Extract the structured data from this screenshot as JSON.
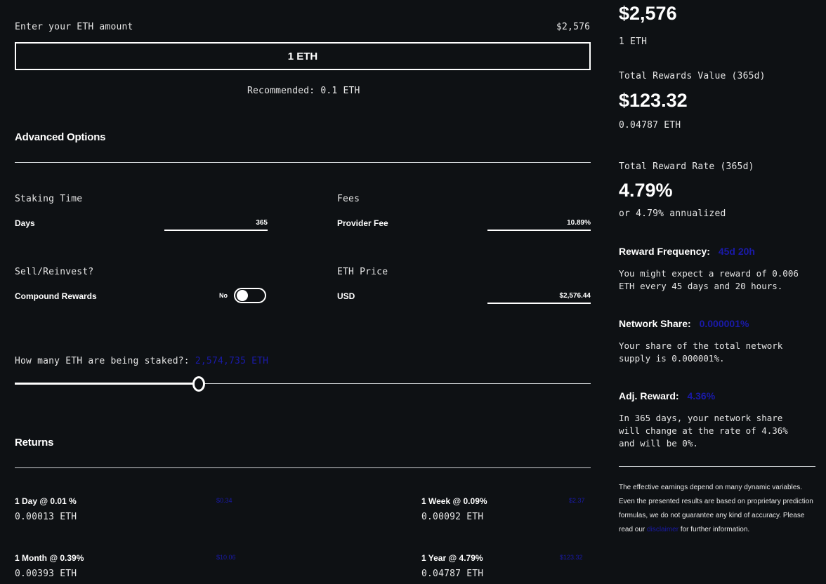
{
  "stake": {
    "amount_label": "Enter your ETH amount",
    "amount_usd": "$2,576",
    "input_value": "1 ETH",
    "recommended": "Recommended: 0.1 ETH"
  },
  "advanced": {
    "title": "Advanced Options",
    "staking_time": {
      "label": "Staking Time",
      "field_label": "Days",
      "value": "365"
    },
    "fees": {
      "label": "Fees",
      "field_label": "Provider Fee",
      "value": "10.89%"
    },
    "sell_reinvest": {
      "label": "Sell/Reinvest?",
      "field_label": "Compound Rewards",
      "toggle_text": "No"
    },
    "eth_price": {
      "label": "ETH Price",
      "field_label": "USD",
      "value": "$2,576.44"
    }
  },
  "slider": {
    "label": "How many ETH are being staked?:",
    "value_text": "2,574,735 ETH",
    "fill_fraction": 0.32
  },
  "returns": {
    "title": "Returns",
    "items": [
      {
        "title": "1 Day @ 0.01 %",
        "usd": "$0.34",
        "eth": "0.00013 ETH"
      },
      {
        "title": "1 Week @ 0.09%",
        "usd": "$2.37",
        "eth": "0.00092 ETH"
      },
      {
        "title": "1 Month @ 0.39%",
        "usd": "$10.06",
        "eth": "0.00393 ETH"
      },
      {
        "title": "1 Year @ 4.79%",
        "usd": "$123.32",
        "eth": "0.04787 ETH"
      }
    ]
  },
  "summary": {
    "top_value": "$2,576",
    "top_eth": "1 ETH",
    "total_rewards_label": "Total Rewards Value (365d)",
    "total_rewards_value": "$123.32",
    "total_rewards_eth": "0.04787 ETH",
    "reward_rate_label": "Total Reward Rate (365d)",
    "reward_rate_value": "4.79%",
    "reward_rate_sub": "or 4.79% annualized",
    "reward_frequency": {
      "label": "Reward Frequency:",
      "value": "45d 20h",
      "text": "You might expect a reward of 0.006 ETH every 45 days and 20 hours."
    },
    "network_share": {
      "label": "Network Share:",
      "value": "0.000001%",
      "text": "Your share of the total network supply is 0.000001%."
    },
    "adj_reward": {
      "label": "Adj. Reward:",
      "value": "4.36%",
      "text": "In 365 days, your network share will change at the rate of 4.36% and will be 0%."
    },
    "disclaimer_pre": "The effective earnings depend on many dynamic variables. Even the presented results are based on proprietary prediction formulas, we do not guarantee any kind of accuracy. Please read our",
    "disclaimer_link": "disclaimer",
    "disclaimer_post": "for further information."
  },
  "colors": {
    "background": "#0e1114",
    "text": "#ffffff",
    "link": "#1a1aa8"
  }
}
